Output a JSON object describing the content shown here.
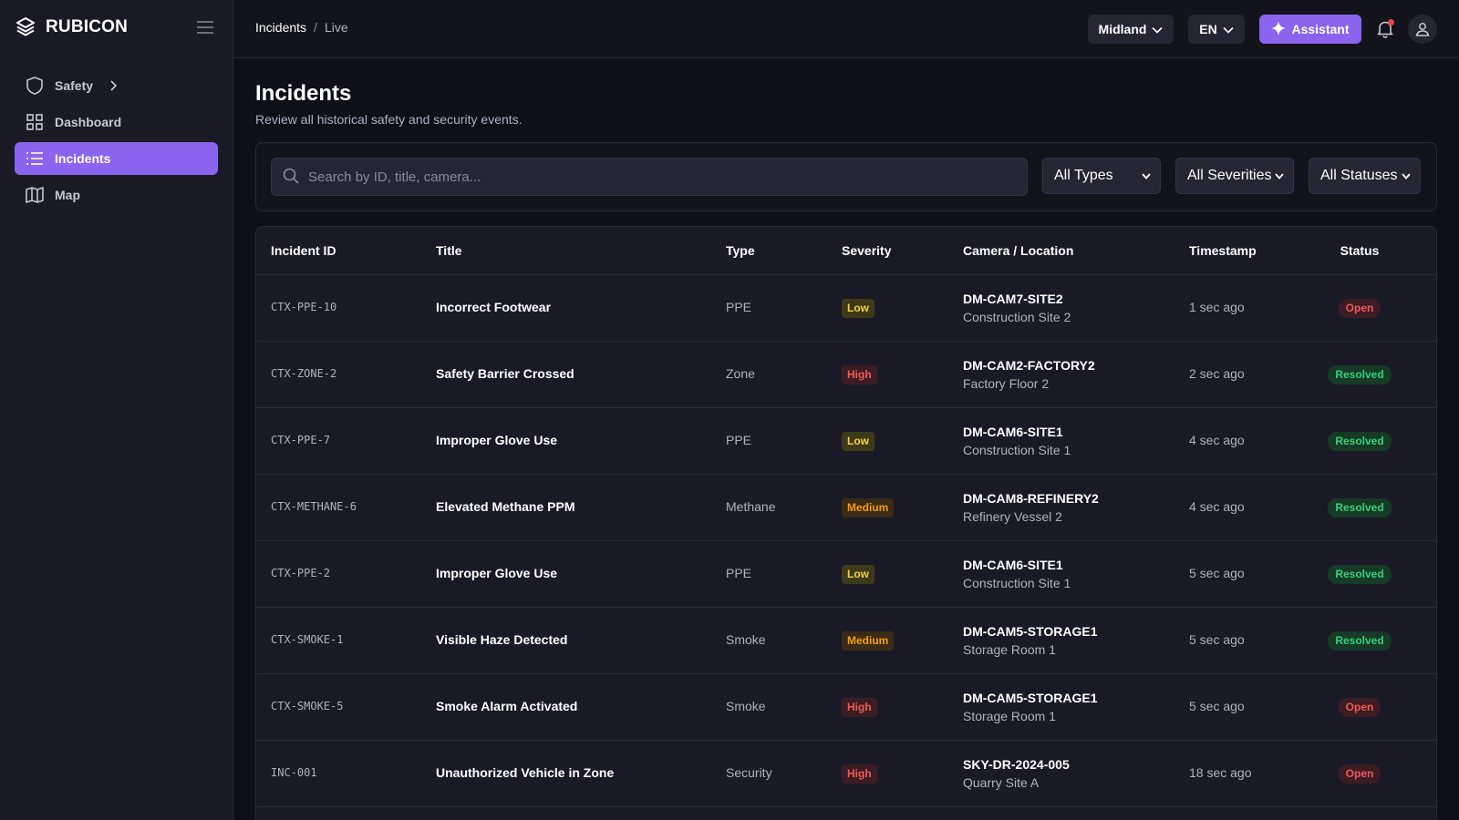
{
  "app": {
    "brand": "RUBICON"
  },
  "sidebar": {
    "items": [
      {
        "label": "Safety",
        "icon": "shield-icon",
        "expandable": true,
        "active": false
      },
      {
        "label": "Dashboard",
        "icon": "grid-icon",
        "active": false
      },
      {
        "label": "Incidents",
        "icon": "list-icon",
        "active": true
      },
      {
        "label": "Map",
        "icon": "map-icon",
        "active": false
      }
    ]
  },
  "header": {
    "breadcrumb": [
      "Incidents",
      "Live"
    ],
    "breadcrumb_separator": "/",
    "region": "Midland",
    "language": "EN",
    "assistant_label": "Assistant"
  },
  "page": {
    "title": "Incidents",
    "subtitle": "Review all historical safety and security events."
  },
  "filters": {
    "search_placeholder": "Search by ID, title, camera...",
    "type": "All Types",
    "severity": "All Severities",
    "status": "All Statuses"
  },
  "table": {
    "columns": [
      "Incident ID",
      "Title",
      "Type",
      "Severity",
      "Camera / Location",
      "Timestamp",
      "Status"
    ],
    "rows": [
      {
        "id": "CTX-PPE-10",
        "title": "Incorrect Footwear",
        "type": "PPE",
        "severity": "Low",
        "camera": "DM-CAM7-SITE2",
        "location": "Construction Site 2",
        "timestamp": "1 sec ago",
        "status": "Open"
      },
      {
        "id": "CTX-ZONE-2",
        "title": "Safety Barrier Crossed",
        "type": "Zone",
        "severity": "High",
        "camera": "DM-CAM2-FACTORY2",
        "location": "Factory Floor 2",
        "timestamp": "2 sec ago",
        "status": "Resolved"
      },
      {
        "id": "CTX-PPE-7",
        "title": "Improper Glove Use",
        "type": "PPE",
        "severity": "Low",
        "camera": "DM-CAM6-SITE1",
        "location": "Construction Site 1",
        "timestamp": "4 sec ago",
        "status": "Resolved"
      },
      {
        "id": "CTX-METHANE-6",
        "title": "Elevated Methane PPM",
        "type": "Methane",
        "severity": "Medium",
        "camera": "DM-CAM8-REFINERY2",
        "location": "Refinery Vessel 2",
        "timestamp": "4 sec ago",
        "status": "Resolved"
      },
      {
        "id": "CTX-PPE-2",
        "title": "Improper Glove Use",
        "type": "PPE",
        "severity": "Low",
        "camera": "DM-CAM6-SITE1",
        "location": "Construction Site 1",
        "timestamp": "5 sec ago",
        "status": "Resolved"
      },
      {
        "id": "CTX-SMOKE-1",
        "title": "Visible Haze Detected",
        "type": "Smoke",
        "severity": "Medium",
        "camera": "DM-CAM5-STORAGE1",
        "location": "Storage Room 1",
        "timestamp": "5 sec ago",
        "status": "Resolved"
      },
      {
        "id": "CTX-SMOKE-5",
        "title": "Smoke Alarm Activated",
        "type": "Smoke",
        "severity": "High",
        "camera": "DM-CAM5-STORAGE1",
        "location": "Storage Room 1",
        "timestamp": "5 sec ago",
        "status": "Open"
      },
      {
        "id": "INC-001",
        "title": "Unauthorized Vehicle in Zone",
        "type": "Security",
        "severity": "High",
        "camera": "SKY-DR-2024-005",
        "location": "Quarry Site A",
        "timestamp": "18 sec ago",
        "status": "Open"
      }
    ]
  },
  "colors": {
    "accent": "#8a63ee",
    "background": "#0f0f17",
    "panel": "#1a1a26",
    "severity_low": "#f5d142",
    "severity_medium": "#f59e0b",
    "severity_high": "#f05a5a",
    "status_open": "#f05a5a",
    "status_resolved": "#34d07a"
  }
}
